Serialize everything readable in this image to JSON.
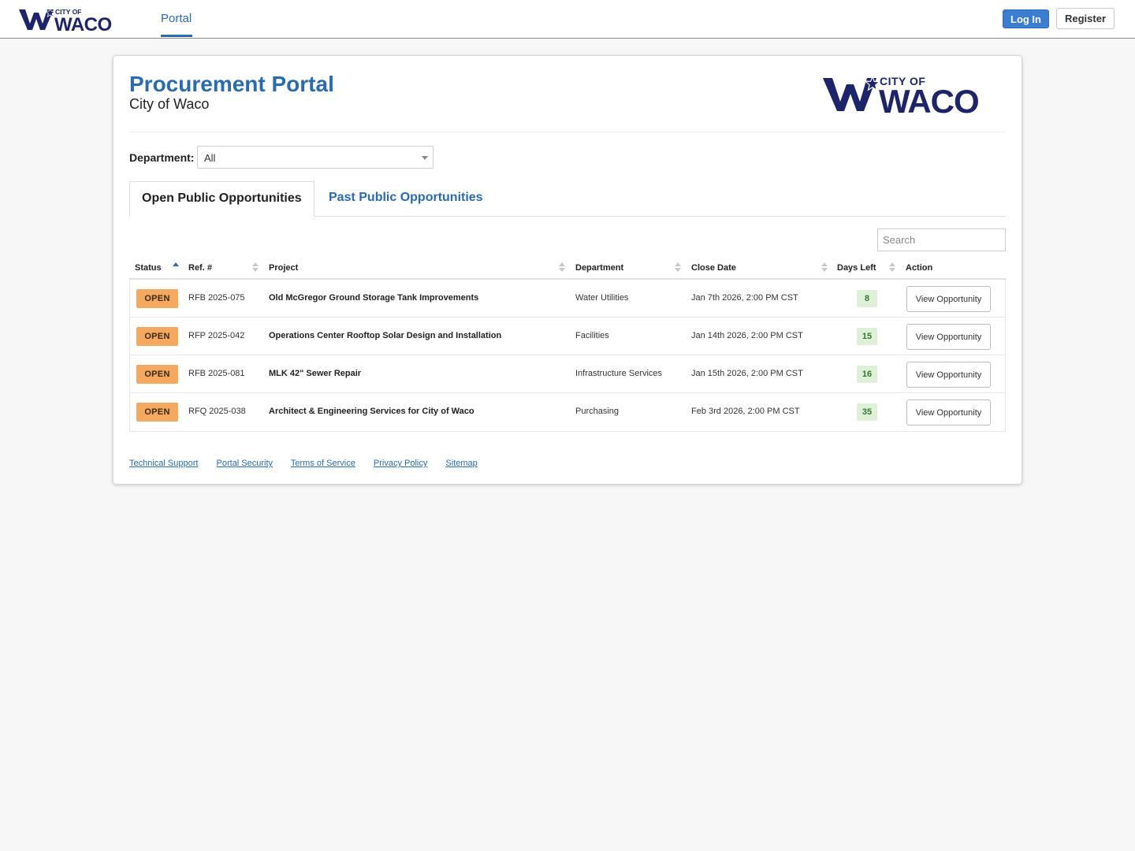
{
  "nav": {
    "logo": {
      "line1": "CITY OF",
      "line2": "WACO"
    },
    "tab": "Portal",
    "login_label": "Log In",
    "register_label": "Register"
  },
  "header": {
    "title": "Procurement Portal",
    "subtitle": "City of Waco",
    "logo": {
      "line1": "CITY OF",
      "line2": "WACO"
    }
  },
  "filter": {
    "label": "Department:",
    "selected": "All"
  },
  "tabs": [
    {
      "label": "Open Public Opportunities",
      "active": true
    },
    {
      "label": "Past Public Opportunities",
      "active": false
    }
  ],
  "search": {
    "placeholder": "Search"
  },
  "table": {
    "columns": [
      "Status",
      "Ref. #",
      "Project",
      "Department",
      "Close Date",
      "Days Left",
      "Action"
    ],
    "rows": [
      {
        "status": "OPEN",
        "ref": "RFB 2025-075",
        "project": "Old McGregor Ground Storage Tank Improvements",
        "department": "Water Utilities",
        "close_date": "Jan 7th 2026, 2:00 PM CST",
        "days_left": "8",
        "action": "View Opportunity"
      },
      {
        "status": "OPEN",
        "ref": "RFP 2025-042",
        "project": "Operations Center Rooftop Solar Design and Installation",
        "department": "Facilities",
        "close_date": "Jan 14th 2026, 2:00 PM CST",
        "days_left": "15",
        "action": "View Opportunity"
      },
      {
        "status": "OPEN",
        "ref": "RFB 2025-081",
        "project": "MLK 42\" Sewer Repair",
        "department": "Infrastructure Services",
        "close_date": "Jan 15th 2026, 2:00 PM CST",
        "days_left": "16",
        "action": "View Opportunity"
      },
      {
        "status": "OPEN",
        "ref": "RFQ 2025-038",
        "project": "Architect & Engineering Services for City of Waco",
        "department": "Purchasing",
        "close_date": "Feb 3rd 2026, 2:00 PM CST",
        "days_left": "35",
        "action": "View Opportunity"
      }
    ]
  },
  "footer": {
    "links": [
      "Technical Support",
      "Portal Security",
      "Terms of Service",
      "Privacy Policy",
      "Sitemap"
    ]
  },
  "colors": {
    "brand_navy": "#1e2469",
    "link_blue": "#2a6bb0",
    "login_blue": "#3a7dd1",
    "open_badge": "#f4a860",
    "days_badge_bg": "#dff0d8",
    "days_badge_text": "#2f7a2f"
  },
  "icons": {
    "logo": "city-of-waco-w-star-logo",
    "sort": "sort-arrows-icon",
    "select_caret": "caret-down-icon"
  }
}
